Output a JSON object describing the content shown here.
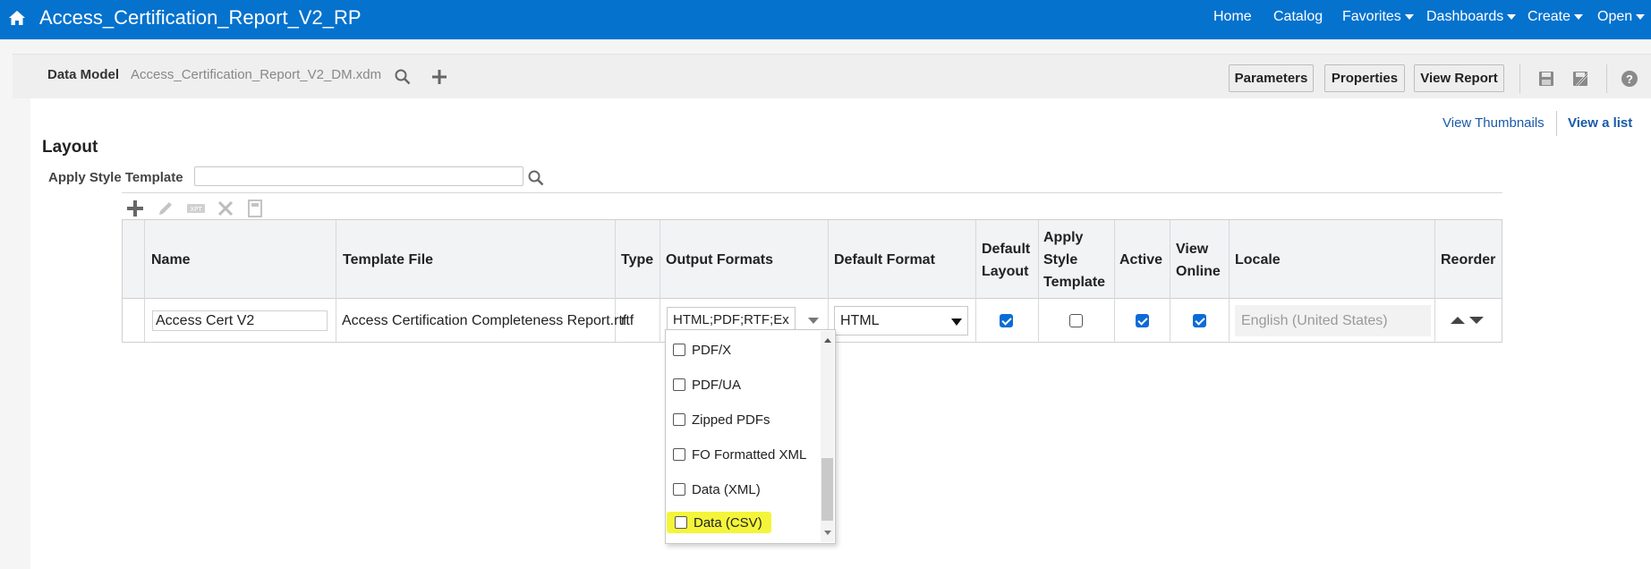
{
  "header": {
    "title": "Access_Certification_Report_V2_RP",
    "nav": [
      {
        "label": "Home",
        "dropdown": false
      },
      {
        "label": "Catalog",
        "dropdown": false
      },
      {
        "label": "Favorites",
        "dropdown": true
      },
      {
        "label": "Dashboards",
        "dropdown": true
      },
      {
        "label": "Create",
        "dropdown": true
      },
      {
        "label": "Open",
        "dropdown": true
      }
    ],
    "bar_color": "#0572ce"
  },
  "datamodel": {
    "label": "Data Model",
    "file": "Access_Certification_Report_V2_DM.xdm"
  },
  "actions": {
    "parameters": "Parameters",
    "properties": "Properties",
    "view_report": "View Report"
  },
  "view_links": {
    "thumbnails": "View Thumbnails",
    "list": "View a list"
  },
  "layout": {
    "heading": "Layout",
    "apply_style_label": "Apply Style Template",
    "apply_style_value": ""
  },
  "table": {
    "headers": {
      "name": "Name",
      "template_file": "Template File",
      "type": "Type",
      "output_formats": "Output Formats",
      "default_format": "Default Format",
      "default_layout": [
        "Default",
        "Layout"
      ],
      "apply_style_template": [
        "Apply",
        "Style",
        "Template"
      ],
      "active": "Active",
      "view_online": [
        "View",
        "Online"
      ],
      "locale": "Locale",
      "reorder": "Reorder"
    },
    "row": {
      "name": "Access Cert V2",
      "template_file": "Access Certification Completeness Report.rtf",
      "type": "rtf",
      "output_formats": "HTML;PDF;RTF;Ex",
      "default_format": "HTML",
      "default_layout": true,
      "apply_style_template": false,
      "active": true,
      "view_online": true,
      "locale": "English (United States)"
    }
  },
  "output_format_options": [
    {
      "label": "PDF/X",
      "checked": false,
      "highlighted": false
    },
    {
      "label": "PDF/UA",
      "checked": false,
      "highlighted": false
    },
    {
      "label": "Zipped PDFs",
      "checked": false,
      "highlighted": false
    },
    {
      "label": "FO Formatted XML",
      "checked": false,
      "highlighted": false
    },
    {
      "label": "Data (XML)",
      "checked": false,
      "highlighted": false
    },
    {
      "label": "Data (CSV)",
      "checked": false,
      "highlighted": true
    }
  ],
  "colors": {
    "link": "#1a5aa8",
    "checkbox_on": "#0b6cd6",
    "highlight": "#f4f53a"
  }
}
